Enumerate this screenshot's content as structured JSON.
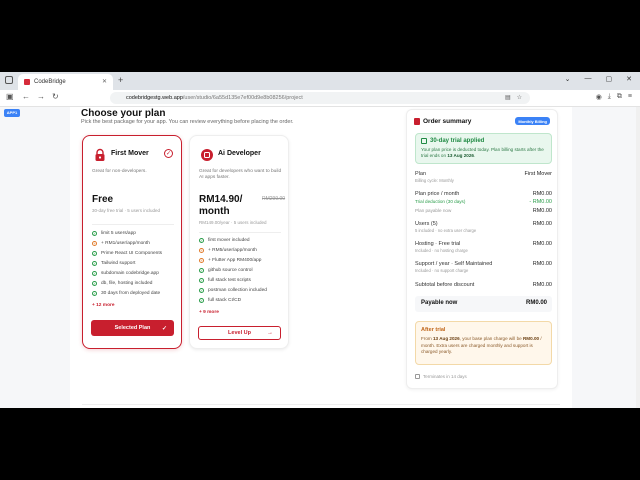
{
  "browser": {
    "tab_title": "CodeBridge",
    "url_host": "codebridgestg.web.app",
    "url_path": "/user/studio/6a55d135e7ef00d9e8b08256/project",
    "app_badge": "APP1"
  },
  "page": {
    "title": "Choose your plan",
    "subtitle": "Pick the best package for your app. You can review everything before placing the order."
  },
  "plans": [
    {
      "name": "First Mover",
      "description": "Great for non-developers.",
      "price": "Free",
      "note": "30-day free trial · 5 users included",
      "features": [
        {
          "text": "limit 5 users/app",
          "kind": "check"
        },
        {
          "text": "+ RM1/user/app/month",
          "kind": "plus"
        },
        {
          "text": "Prime React UI Components",
          "kind": "check"
        },
        {
          "text": "Tailwind support",
          "kind": "check"
        },
        {
          "text": "subdomain codebridge.app",
          "kind": "check"
        },
        {
          "text": "db, file, hosting included",
          "kind": "check"
        },
        {
          "text": "30 days from deployed date",
          "kind": "check"
        }
      ],
      "more": "+ 12 more",
      "button": "Selected Plan"
    },
    {
      "name": "Ai Developer",
      "description": "Great for developers who want to build AI apps faster.",
      "price": "RM14.90/ month",
      "strike_price": "RM299.00",
      "note": "RM149.00/year · 5 users included",
      "features": [
        {
          "text": "first mover included",
          "kind": "check"
        },
        {
          "text": "+ RM5/user/app/month",
          "kind": "plus"
        },
        {
          "text": "+ Flutter App RM400/app",
          "kind": "plus"
        },
        {
          "text": "github source control",
          "kind": "check"
        },
        {
          "text": "full stack test scripts",
          "kind": "check"
        },
        {
          "text": "postman collection included",
          "kind": "check"
        },
        {
          "text": "full stack CI/CD",
          "kind": "check"
        }
      ],
      "more": "+ 9 more",
      "button": "Level Up"
    }
  ],
  "summary": {
    "title": "Order summary",
    "badge": "Monthly Billing",
    "trial_title": "30-day trial applied",
    "trial_desc_1": "Your plan price is deducted today. Plan billing starts after the trial ends on ",
    "trial_date": "13 Aug 2026",
    "trial_desc_2": ".",
    "rows": [
      {
        "label": "Plan",
        "sub": "Billing cycle: Monthly",
        "value": "First Mover"
      },
      {
        "label": "Plan price / month",
        "value": "RM0.00"
      },
      {
        "label": "Trial deduction (30 days)",
        "value": "- RM0.00"
      },
      {
        "label": "Plan payable now",
        "value": "RM0.00"
      },
      {
        "label": "Users (5)",
        "sub": "5 included · no extra user charge",
        "value": "RM0.00"
      },
      {
        "label": "Hosting · Free trial",
        "sub": "Included · no hosting charge",
        "value": "RM0.00"
      },
      {
        "label": "Support / year · Self Maintained",
        "sub": "Included · no support charge",
        "value": "RM0.00"
      },
      {
        "label": "Subtotal before discount",
        "value": "RM0.00"
      }
    ],
    "payable_label": "Payable now",
    "payable_value": "RM0.00",
    "after_title": "After trial",
    "after_desc_1": "From ",
    "after_date": "13 Aug 2026",
    "after_desc_2": ", your base plan charge will be ",
    "after_amount": "RM0.00",
    "after_desc_3": " / month. Extra users are charged monthly and support is charged yearly.",
    "terminates": "Terminates in 14 days"
  },
  "colors": {
    "brand": "#c81f2e",
    "green": "#2a9d4a",
    "blue": "#3b82f6"
  }
}
